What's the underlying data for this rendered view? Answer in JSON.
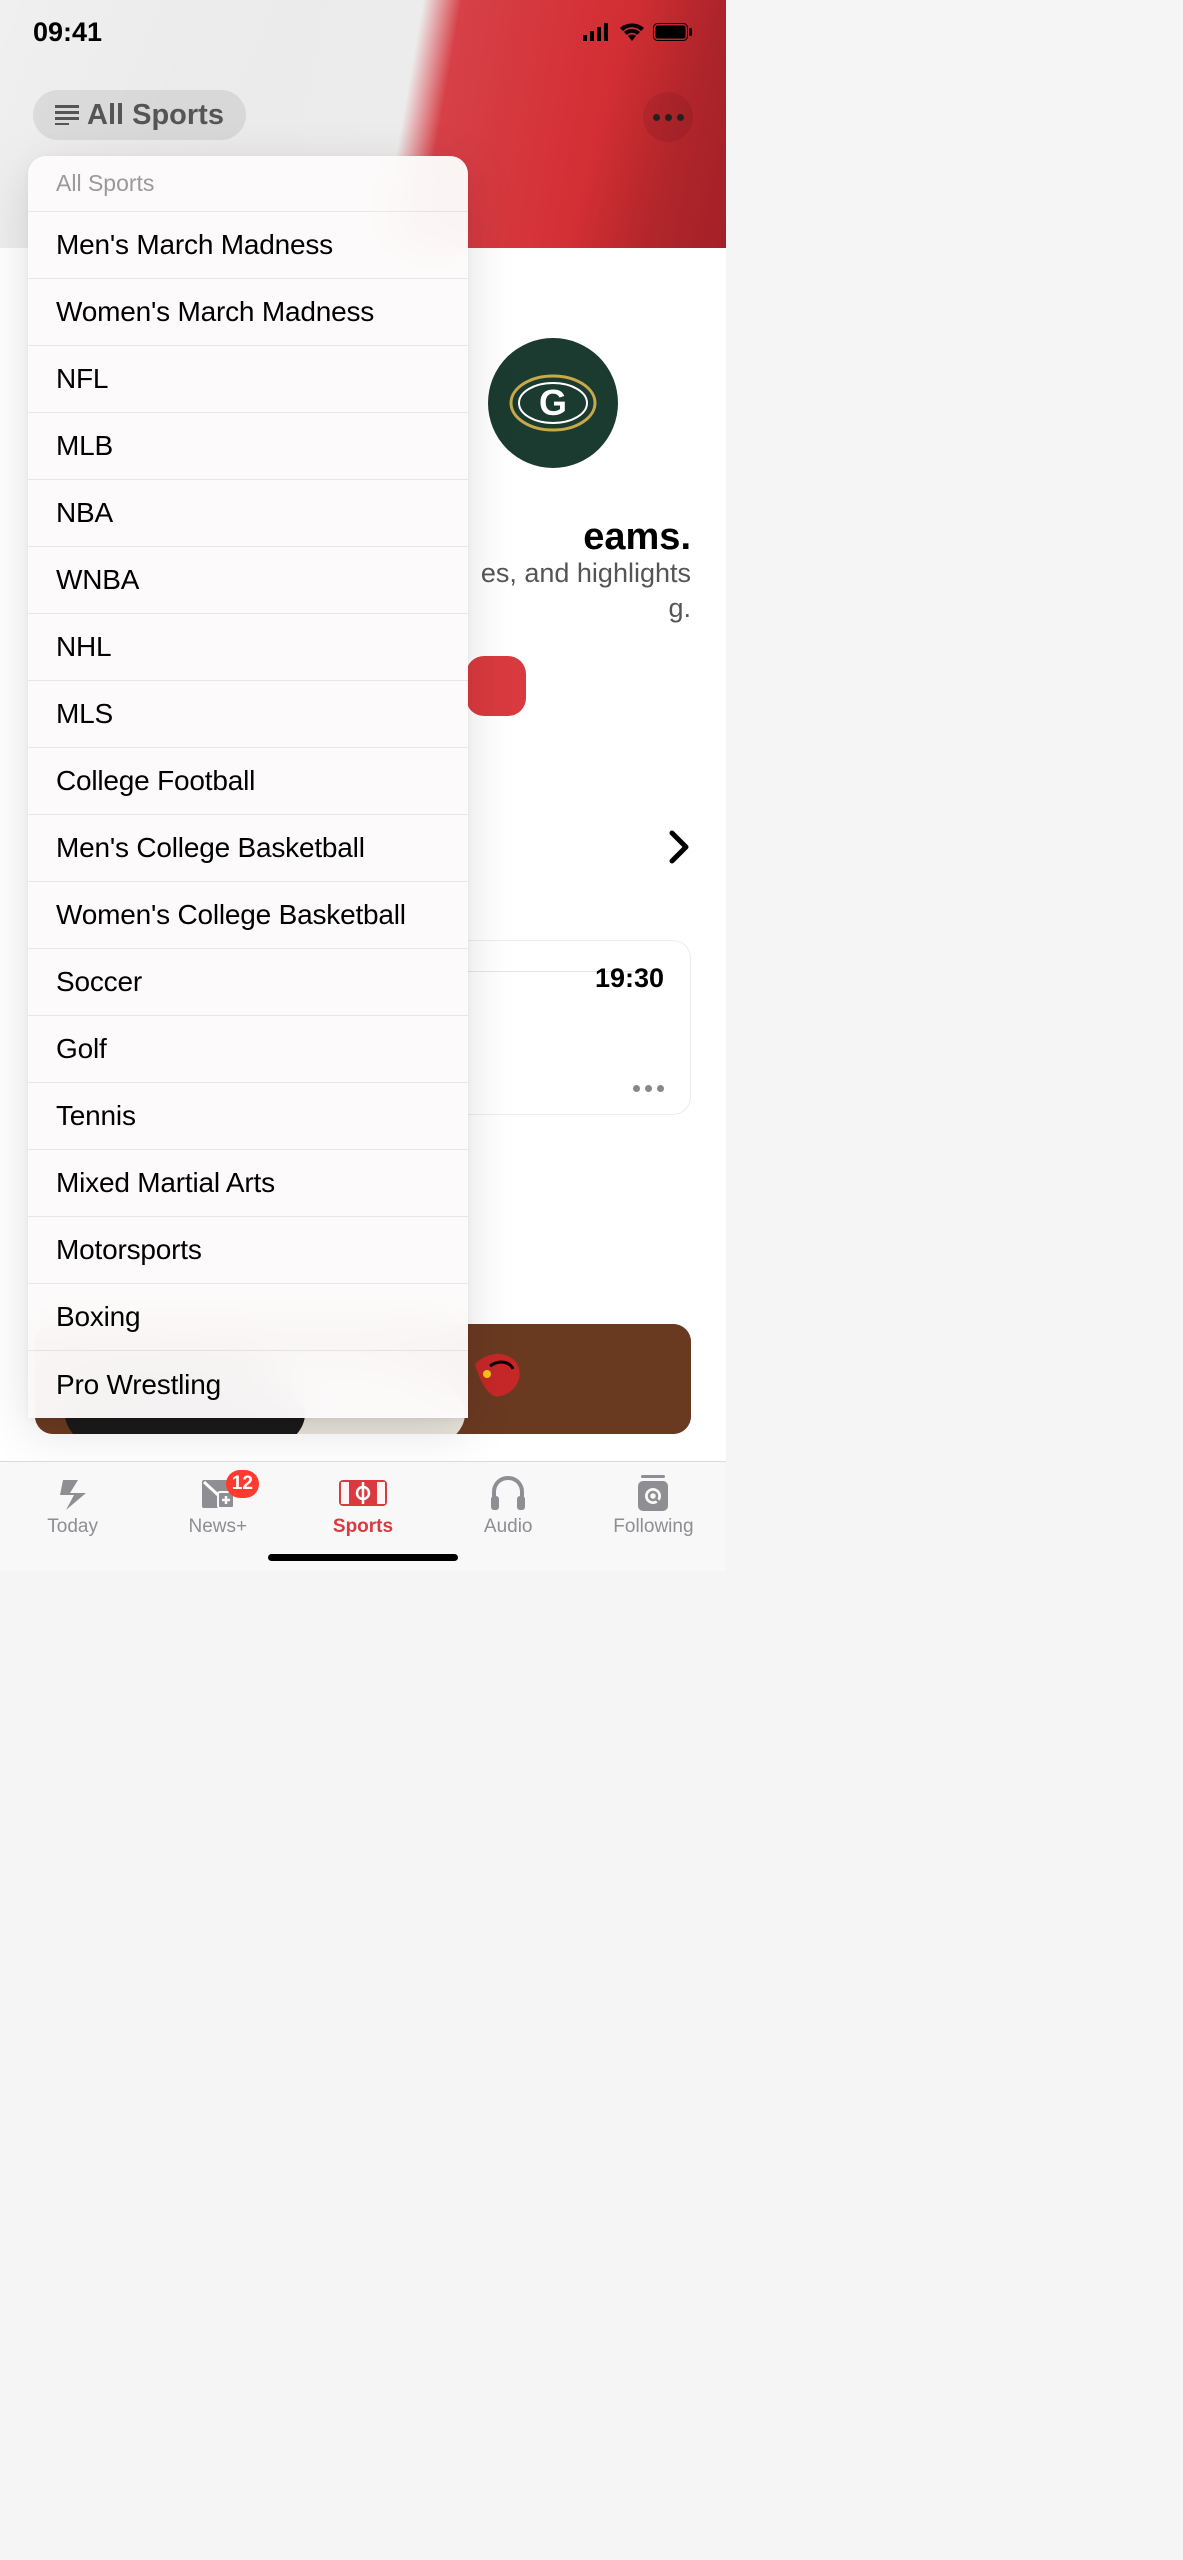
{
  "status": {
    "time": "09:41"
  },
  "header": {
    "all_sports_label": "All Sports"
  },
  "dropdown": {
    "title": "All Sports",
    "items": [
      "Men's March Madness",
      "Women's March Madness",
      "NFL",
      "MLB",
      "NBA",
      "WNBA",
      "NHL",
      "MLS",
      "College Football",
      "Men's College Basketball",
      "Women's College Basketball",
      "Soccer",
      "Golf",
      "Tennis",
      "Mixed Martial Arts",
      "Motorsports",
      "Boxing",
      "Pro Wrestling"
    ]
  },
  "promo": {
    "title_fragment": "eams.",
    "sub_line1": "es, and highlights",
    "sub_line2": "g."
  },
  "card": {
    "time": "19:30"
  },
  "tabs": {
    "today": "Today",
    "newsplus": "News+",
    "newsplus_badge": "12",
    "sports": "Sports",
    "audio": "Audio",
    "following": "Following"
  },
  "colors": {
    "accent": "#d93a3f",
    "inactive": "#8e8e93"
  }
}
